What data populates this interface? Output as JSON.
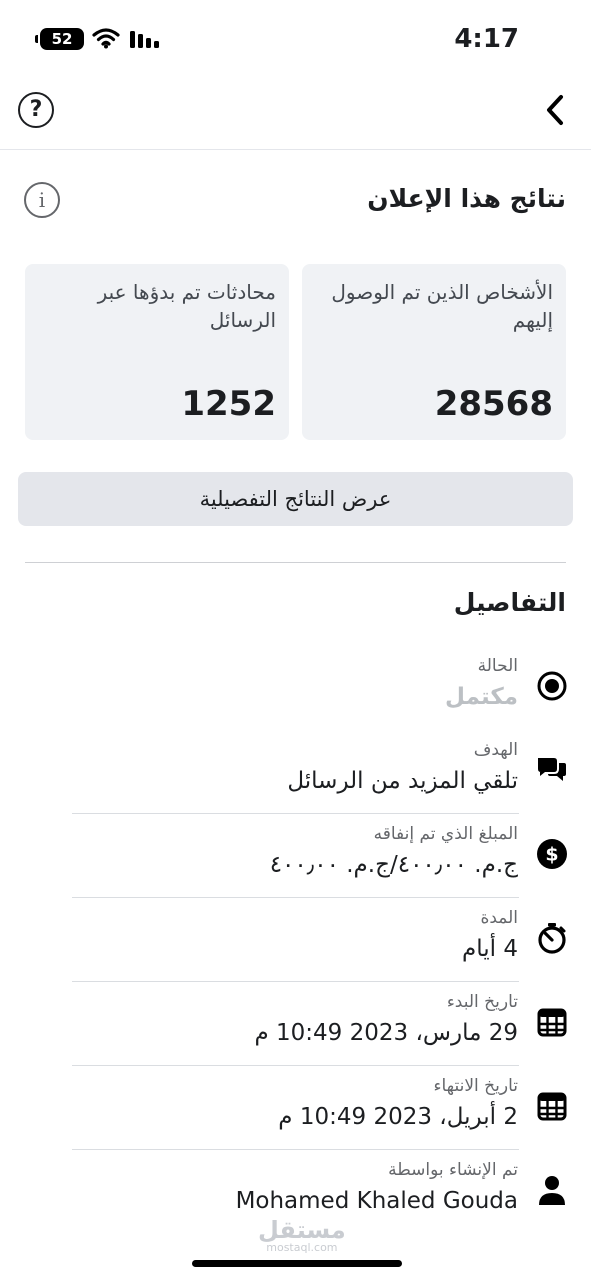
{
  "status_bar": {
    "battery": "52",
    "time": "4:17"
  },
  "results": {
    "title": "نتائج هذا الإعلان",
    "stats": [
      {
        "label": "الأشخاص الذين تم الوصول إليهم",
        "value": "28568"
      },
      {
        "label": "محادثات تم بدؤها عبر الرسائل",
        "value": "1252"
      }
    ],
    "detailed_button": "عرض النتائج التفصيلية"
  },
  "details": {
    "title": "التفاصيل",
    "rows": [
      {
        "label": "الحالة",
        "value": "مكتمل",
        "icon": "status-target-icon"
      },
      {
        "label": "الهدف",
        "value": "تلقي المزيد من الرسائل",
        "icon": "chat-bubbles-icon"
      },
      {
        "label": "المبلغ الذي تم إنفاقه",
        "value": "ج.م. ٤٠٠٫٠٠/ج.م. ٤٠٠٫٠٠",
        "icon": "dollar-coin-icon"
      },
      {
        "label": "المدة",
        "value": "4 أيام",
        "icon": "stopwatch-icon"
      },
      {
        "label": "تاريخ البدء",
        "value": "29 مارس، 2023 10:49 م",
        "icon": "calendar-icon"
      },
      {
        "label": "تاريخ الانتهاء",
        "value": "2 أبريل، 2023 10:49 م",
        "icon": "calendar-icon"
      },
      {
        "label": "تم الإنشاء بواسطة",
        "value": "Mohamed Khaled Gouda",
        "icon": "person-icon"
      }
    ]
  },
  "watermark": {
    "text": "مستقل",
    "sub": "mostaql.com"
  }
}
